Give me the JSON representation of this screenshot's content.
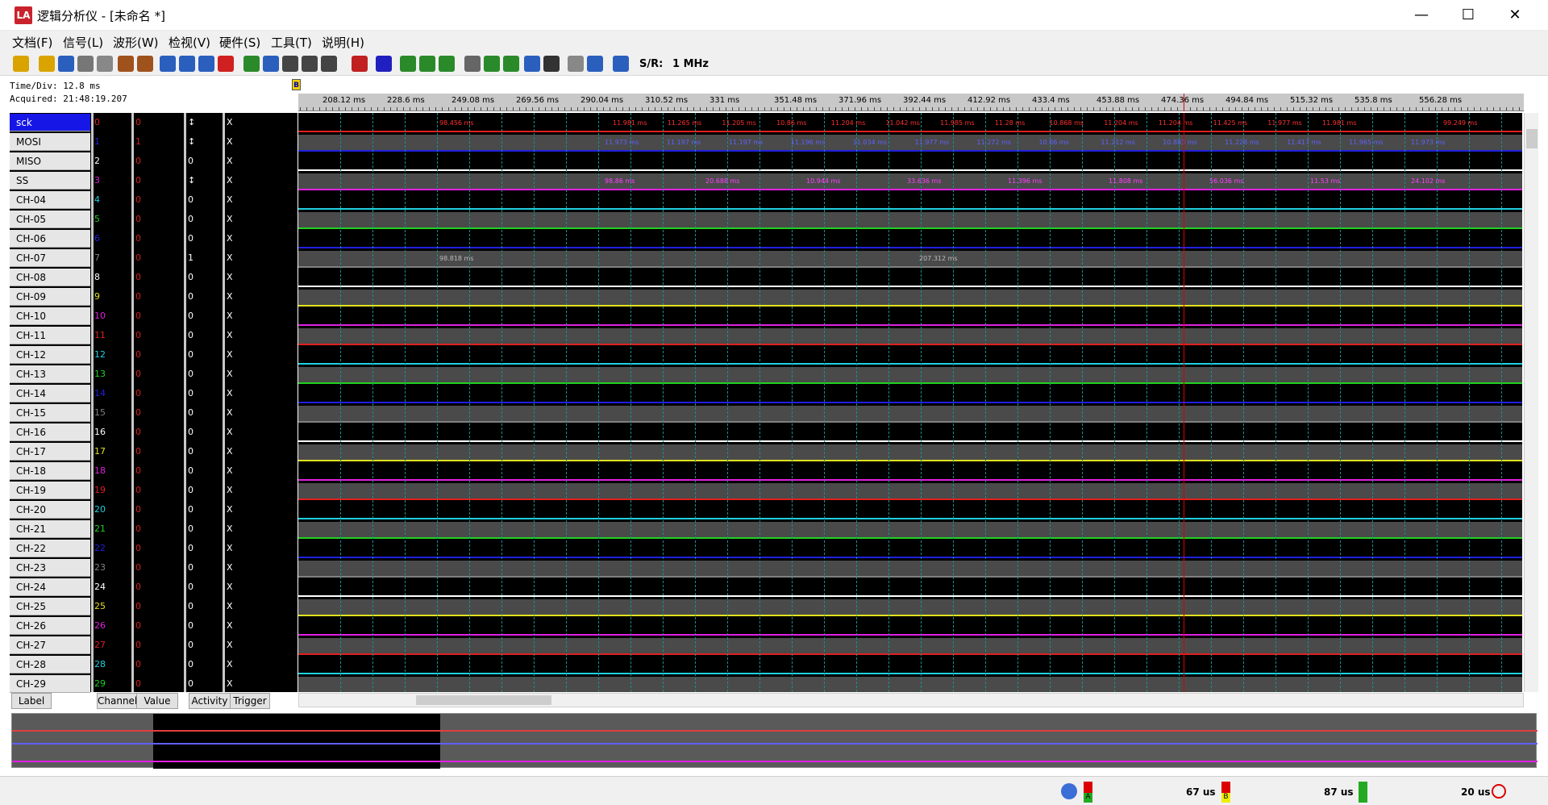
{
  "window": {
    "title": "逻辑分析仪 - [未命名 *]",
    "app_icon": "LA",
    "minimize": "—",
    "maximize": "☐",
    "close": "✕"
  },
  "menu": [
    "文档(F)",
    "信号(L)",
    "波形(W)",
    "检视(V)",
    "硬件(S)",
    "工具(T)",
    "说明(H)"
  ],
  "toolbar": {
    "sr_label": "S/R:",
    "sr_value": "1 MHz",
    "icons": [
      "wand-icon",
      "open-icon",
      "save-icon",
      "print-icon",
      "copy-icon",
      "paste-icon",
      "export-icon",
      "start-icon",
      "single-icon",
      "repeat-icon",
      "stop-icon",
      "cloud-up-icon",
      "cloud-down-icon",
      "zoom-in-icon",
      "zoom-out-icon",
      "zoom-fit-icon",
      "trigger-icon",
      "filter-icon",
      "plugin-icon",
      "cursor-icon",
      "grid-icon",
      "settings-icon",
      "compare-icon",
      "refresh-icon",
      "layout-icon",
      "list-icon",
      "wrench-icon",
      "info-icon",
      "edit-icon"
    ]
  },
  "info": {
    "time_div": "Time/Div: 12.8 ms",
    "acquired": "Acquired: 21:48:19.207",
    "marker": "B"
  },
  "ruler_ticks": [
    "208.12 ms",
    "228.6 ms",
    "249.08 ms",
    "269.56 ms",
    "290.04 ms",
    "310.52 ms",
    "331 ms",
    "351.48 ms",
    "371.96 ms",
    "392.44 ms",
    "412.92 ms",
    "433.4 ms",
    "453.88 ms",
    "474.36 ms",
    "494.84 ms",
    "515.32 ms",
    "535.8 ms",
    "556.28 ms"
  ],
  "channels": [
    {
      "label": "sck",
      "ch": "0",
      "value": "0",
      "activity": "↕",
      "trigger": "X",
      "color": "#e02020"
    },
    {
      "label": "MOSI",
      "ch": "1",
      "value": "1",
      "activity": "↕",
      "trigger": "X",
      "color": "#2020e0"
    },
    {
      "label": "MISO",
      "ch": "2",
      "value": "0",
      "activity": "0",
      "trigger": "X",
      "color": "#ffffff"
    },
    {
      "label": "SS",
      "ch": "3",
      "value": "0",
      "activity": "↕",
      "trigger": "X",
      "color": "#e020e0"
    },
    {
      "label": "CH-04",
      "ch": "4",
      "value": "0",
      "activity": "0",
      "trigger": "X",
      "color": "#20d0e0"
    },
    {
      "label": "CH-05",
      "ch": "5",
      "value": "0",
      "activity": "0",
      "trigger": "X",
      "color": "#20d020"
    },
    {
      "label": "CH-06",
      "ch": "6",
      "value": "0",
      "activity": "0",
      "trigger": "X",
      "color": "#2020e0"
    },
    {
      "label": "CH-07",
      "ch": "7",
      "value": "0",
      "activity": "1",
      "trigger": "X",
      "color": "#808080"
    },
    {
      "label": "CH-08",
      "ch": "8",
      "value": "0",
      "activity": "0",
      "trigger": "X",
      "color": "#ffffff"
    },
    {
      "label": "CH-09",
      "ch": "9",
      "value": "0",
      "activity": "0",
      "trigger": "X",
      "color": "#e0e020"
    },
    {
      "label": "CH-10",
      "ch": "10",
      "value": "0",
      "activity": "0",
      "trigger": "X",
      "color": "#e020e0"
    },
    {
      "label": "CH-11",
      "ch": "11",
      "value": "0",
      "activity": "0",
      "trigger": "X",
      "color": "#e02020"
    },
    {
      "label": "CH-12",
      "ch": "12",
      "value": "0",
      "activity": "0",
      "trigger": "X",
      "color": "#20d0e0"
    },
    {
      "label": "CH-13",
      "ch": "13",
      "value": "0",
      "activity": "0",
      "trigger": "X",
      "color": "#20d020"
    },
    {
      "label": "CH-14",
      "ch": "14",
      "value": "0",
      "activity": "0",
      "trigger": "X",
      "color": "#2020e0"
    },
    {
      "label": "CH-15",
      "ch": "15",
      "value": "0",
      "activity": "0",
      "trigger": "X",
      "color": "#808080"
    },
    {
      "label": "CH-16",
      "ch": "16",
      "value": "0",
      "activity": "0",
      "trigger": "X",
      "color": "#ffffff"
    },
    {
      "label": "CH-17",
      "ch": "17",
      "value": "0",
      "activity": "0",
      "trigger": "X",
      "color": "#e0e020"
    },
    {
      "label": "CH-18",
      "ch": "18",
      "value": "0",
      "activity": "0",
      "trigger": "X",
      "color": "#e020e0"
    },
    {
      "label": "CH-19",
      "ch": "19",
      "value": "0",
      "activity": "0",
      "trigger": "X",
      "color": "#e02020"
    },
    {
      "label": "CH-20",
      "ch": "20",
      "value": "0",
      "activity": "0",
      "trigger": "X",
      "color": "#20d0e0"
    },
    {
      "label": "CH-21",
      "ch": "21",
      "value": "0",
      "activity": "0",
      "trigger": "X",
      "color": "#20d020"
    },
    {
      "label": "CH-22",
      "ch": "22",
      "value": "0",
      "activity": "0",
      "trigger": "X",
      "color": "#2020e0"
    },
    {
      "label": "CH-23",
      "ch": "23",
      "value": "0",
      "activity": "0",
      "trigger": "X",
      "color": "#808080"
    },
    {
      "label": "CH-24",
      "ch": "24",
      "value": "0",
      "activity": "0",
      "trigger": "X",
      "color": "#ffffff"
    },
    {
      "label": "CH-25",
      "ch": "25",
      "value": "0",
      "activity": "0",
      "trigger": "X",
      "color": "#e0e020"
    },
    {
      "label": "CH-26",
      "ch": "26",
      "value": "0",
      "activity": "0",
      "trigger": "X",
      "color": "#e020e0"
    },
    {
      "label": "CH-27",
      "ch": "27",
      "value": "0",
      "activity": "0",
      "trigger": "X",
      "color": "#e02020"
    },
    {
      "label": "CH-28",
      "ch": "28",
      "value": "0",
      "activity": "0",
      "trigger": "X",
      "color": "#20d0e0"
    },
    {
      "label": "CH-29",
      "ch": "29",
      "value": "0",
      "activity": "0",
      "trigger": "X",
      "color": "#20d020"
    }
  ],
  "wave_labels": {
    "sck": [
      "98.456 ms",
      "11.981 ms",
      "11.265 ms",
      "11.205 ms",
      "10.86 ms",
      "11.204 ms",
      "11.042 ms",
      "11.985 ms",
      "11.28 ms",
      "10.868 ms",
      "11.204 ms",
      "11.204 ms",
      "11.425 ms",
      "11.977 ms",
      "11.981 ms",
      "99.249 ms"
    ],
    "mosi": [
      "11.973 ms",
      "11.197 ms",
      "11.197 ms",
      "11.196 ms",
      "11.034 ms",
      "11.977 ms",
      "11.272 ms",
      "10.86 ms",
      "11.212 ms",
      "10.883 ms",
      "11.228 ms",
      "11.417 ms",
      "11.965 ms",
      "11.973 ms"
    ],
    "ss": [
      "98.86 ms",
      "20.688 ms",
      "10.944 ms",
      "33.636 ms",
      "11.396 ms",
      "11.808 ms",
      "56.036 ms",
      "11.53 ms",
      "24.102 ms"
    ],
    "ch07": [
      "98.818 ms",
      "207.312 ms"
    ]
  },
  "columns": [
    "Label",
    "Channel",
    "Value",
    "Activity",
    "Trigger"
  ],
  "status": {
    "cursor_a_b": "67 us",
    "cursor_b_a": "87 us",
    "period": "20 us",
    "box_a": "A",
    "box_b": "B"
  }
}
